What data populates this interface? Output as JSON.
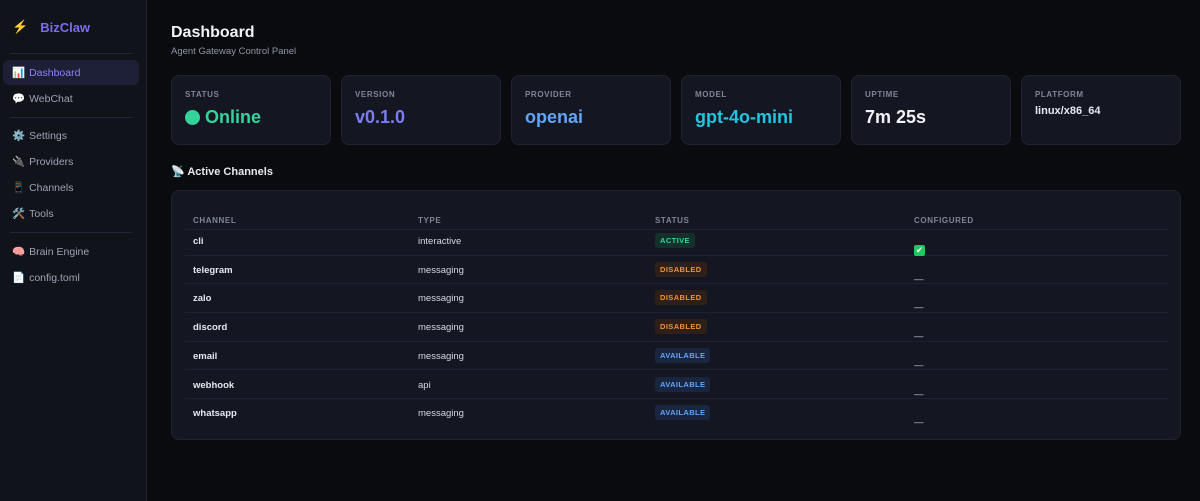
{
  "app": {
    "name": "BizClaw",
    "logo_icon": "lightning"
  },
  "sidebar": {
    "items": [
      {
        "label": "Dashboard",
        "icon": "📊"
      },
      {
        "label": "WebChat",
        "icon": "💬"
      },
      {
        "label": "Settings",
        "icon": "⚙️"
      },
      {
        "label": "Providers",
        "icon": "🔌"
      },
      {
        "label": "Channels",
        "icon": "📱"
      },
      {
        "label": "Tools",
        "icon": "🛠️"
      },
      {
        "label": "Brain Engine",
        "icon": "🧠"
      },
      {
        "label": "config.toml",
        "icon": "📄"
      }
    ]
  },
  "header": {
    "title": "Dashboard",
    "subtitle": "Agent Gateway Control Panel"
  },
  "cards": [
    {
      "label": "STATUS",
      "value": "Online",
      "color": "#34d399"
    },
    {
      "label": "VERSION",
      "value": "v0.1.0",
      "color": "#7c7cf2"
    },
    {
      "label": "PROVIDER",
      "value": "openai",
      "color": "#60a5fa"
    },
    {
      "label": "MODEL",
      "value": "gpt-4o-mini",
      "color": "#22c5e0"
    },
    {
      "label": "UPTIME",
      "value": "7m 25s",
      "color": "#f1f2f6"
    },
    {
      "label": "PLATFORM",
      "value": "linux/x86_64",
      "color": "#e6e8ee"
    }
  ],
  "channels": {
    "title": "Active Channels",
    "icon": "📡",
    "columns": [
      "CHANNEL",
      "TYPE",
      "STATUS",
      "CONFIGURED"
    ],
    "rows": [
      {
        "channel": "cli",
        "type": "interactive",
        "status": "ACTIVE",
        "configured": "✔"
      },
      {
        "channel": "telegram",
        "type": "messaging",
        "status": "DISABLED",
        "configured": "—"
      },
      {
        "channel": "zalo",
        "type": "messaging",
        "status": "DISABLED",
        "configured": "—"
      },
      {
        "channel": "discord",
        "type": "messaging",
        "status": "DISABLED",
        "configured": "—"
      },
      {
        "channel": "email",
        "type": "messaging",
        "status": "AVAILABLE",
        "configured": "—"
      },
      {
        "channel": "webhook",
        "type": "api",
        "status": "AVAILABLE",
        "configured": "—"
      },
      {
        "channel": "whatsapp",
        "type": "messaging",
        "status": "AVAILABLE",
        "configured": "—"
      }
    ]
  }
}
